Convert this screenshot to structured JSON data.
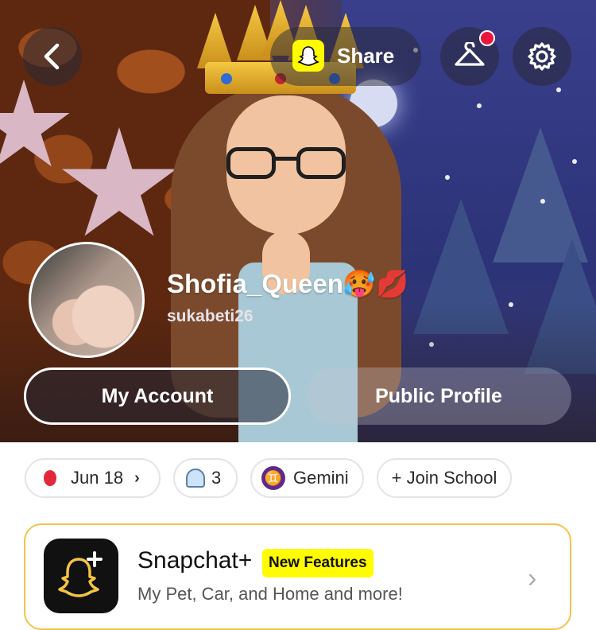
{
  "top_bar": {
    "share_label": "Share"
  },
  "profile": {
    "display_name": "Shofia_Queen🥵💋",
    "username": "sukabeti26"
  },
  "actions": {
    "my_account": "My Account",
    "public_profile": "Public Profile"
  },
  "chips": {
    "birthday": "Jun 18",
    "birthday_chevron": "›",
    "friends_count": "3",
    "zodiac_symbol": "♊",
    "zodiac": "Gemini",
    "school": "+ Join School"
  },
  "snapchat_plus": {
    "title": "Snapchat+",
    "badge": "New Features",
    "subtitle": "My Pet, Car, and Home and more!",
    "chevron": "›"
  },
  "colors": {
    "brand_yellow": "#fffc00",
    "notification_red": "#e8173b",
    "card_border": "#f4c24a"
  },
  "icons": {
    "back": "chevron-left-icon",
    "outfit": "hanger-icon",
    "settings": "gear-icon",
    "snapcode": "snapcode-icon",
    "birthday": "balloon-icon",
    "friends": "ghost-icon",
    "zodiac": "gemini-icon",
    "plus": "snapchat-plus-icon"
  }
}
